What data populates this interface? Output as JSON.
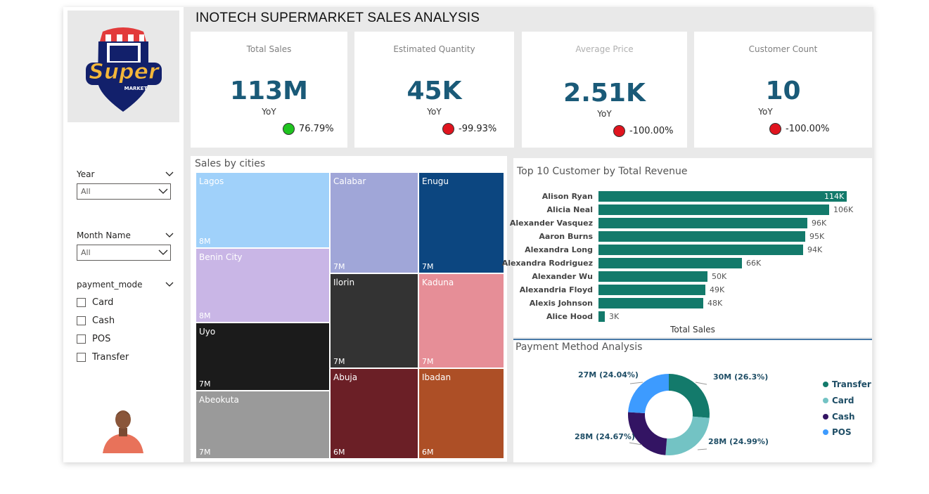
{
  "title": "INOTECH SUPERMARKET SALES ANALYSIS",
  "logo": {
    "text_main": "Super",
    "text_sub": "MARKET"
  },
  "filters": {
    "year": {
      "label": "Year",
      "value": "All"
    },
    "month": {
      "label": "Month Name",
      "value": "All"
    },
    "payment_mode": {
      "label": "payment_mode",
      "options": [
        "Card",
        "Cash",
        "POS",
        "Transfer"
      ]
    }
  },
  "kpis": [
    {
      "label": "Total Sales",
      "value": "113M",
      "yoy_label": "YoY",
      "change": "76.79%",
      "status_color": "#1fc41f"
    },
    {
      "label": "Estimated Quantity",
      "value": "45K",
      "yoy_label": "YoY",
      "change": "-99.93%",
      "status_color": "#e0141e"
    },
    {
      "label": "Average Price",
      "value": "2.51K",
      "yoy_label": "YoY",
      "change": "-100.00%",
      "status_color": "#e0141e"
    },
    {
      "label": "Customer Count",
      "value": "10",
      "yoy_label": "YoY",
      "change": "-100.00%",
      "status_color": "#e0141e"
    }
  ],
  "treemap": {
    "title": "Sales by cities",
    "tiles": [
      {
        "name": "Lagos",
        "value": "8M",
        "color": "#a0d1fa"
      },
      {
        "name": "Benin City",
        "value": "8M",
        "color": "#c9b6e6"
      },
      {
        "name": "Uyo",
        "value": "7M",
        "color": "#1b1b1b"
      },
      {
        "name": "Abeokuta",
        "value": "7M",
        "color": "#9a9a9a"
      },
      {
        "name": "Calabar",
        "value": "7M",
        "color": "#a0a6d8"
      },
      {
        "name": "Ilorin",
        "value": "7M",
        "color": "#333333"
      },
      {
        "name": "Abuja",
        "value": "6M",
        "color": "#6b1f26"
      },
      {
        "name": "Enugu",
        "value": "7M",
        "color": "#0c4680"
      },
      {
        "name": "Kaduna",
        "value": "7M",
        "color": "#e68e97"
      },
      {
        "name": "Ibadan",
        "value": "6M",
        "color": "#ad4f26"
      }
    ]
  },
  "bar_chart": {
    "title": "Top 10 Customer by Total Revenue",
    "xlabel": "Total Sales",
    "bar_color": "#137a6b",
    "customers": [
      {
        "name": "Alison Ryan",
        "value": 114,
        "label": "114K"
      },
      {
        "name": "Alicia Neal",
        "value": 106,
        "label": "106K"
      },
      {
        "name": "Alexander Vasquez",
        "value": 96,
        "label": "96K"
      },
      {
        "name": "Aaron Burns",
        "value": 95,
        "label": "95K"
      },
      {
        "name": "Alexandra Long",
        "value": 94,
        "label": "94K"
      },
      {
        "name": "Alexandra Rodriguez",
        "value": 66,
        "label": "66K"
      },
      {
        "name": "Alexander Wu",
        "value": 50,
        "label": "50K"
      },
      {
        "name": "Alexandria Floyd",
        "value": 49,
        "label": "49K"
      },
      {
        "name": "Alexis Johnson",
        "value": 48,
        "label": "48K"
      },
      {
        "name": "Alice Hood",
        "value": 3,
        "label": "3K"
      }
    ]
  },
  "donut": {
    "title": "Payment Method Analysis",
    "segments": [
      {
        "name": "Transfer",
        "value": 30,
        "label": "30M (26.3%)",
        "pct": 26.3,
        "color": "#137a6b"
      },
      {
        "name": "Card",
        "value": 28,
        "label": "28M (24.99%)",
        "pct": 24.99,
        "color": "#73c3c4"
      },
      {
        "name": "Cash",
        "value": 28,
        "label": "28M (24.67%)",
        "pct": 24.67,
        "color": "#331463"
      },
      {
        "name": "POS",
        "value": 27,
        "label": "27M (24.04%)",
        "pct": 24.04,
        "color": "#3d9bff"
      }
    ]
  }
}
